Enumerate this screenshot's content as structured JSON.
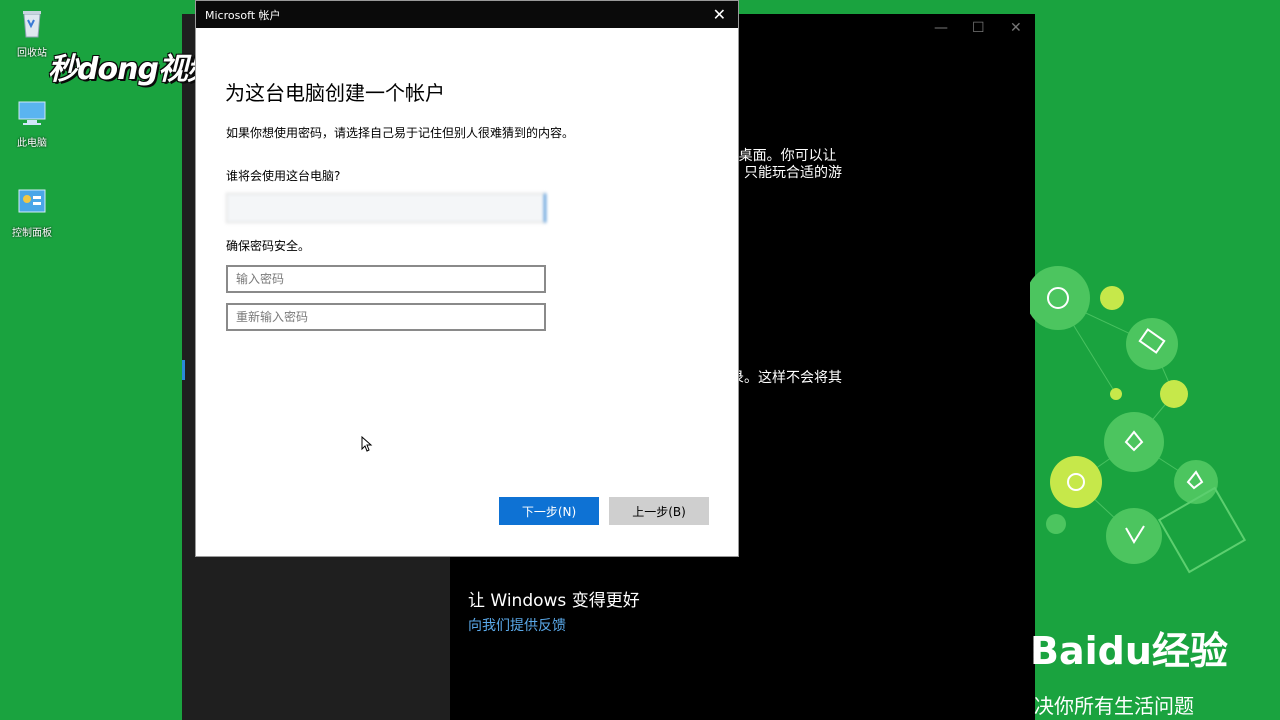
{
  "desktop": {
    "icons": [
      {
        "label": "回收站"
      },
      {
        "label": "此电脑"
      },
      {
        "label": "控制面板"
      }
    ]
  },
  "watermark": {
    "top_left": "秒dong视频",
    "brand_logo": "Baidu经验",
    "brand_sub": "决你所有生活问题"
  },
  "settings_bg": {
    "text1": "o桌面。你可以让\n，只能玩合适的游",
    "text2": "录。这样不会将其",
    "heading": "让 Windows 变得更好",
    "link": "向我们提供反馈"
  },
  "dialog": {
    "window_title": "Microsoft 帐户",
    "title": "为这台电脑创建一个帐户",
    "description": "如果你想使用密码，请选择自己易于记住但别人很难猜到的内容。",
    "who_label": "谁将会使用这台电脑?",
    "security_label": "确保密码安全。",
    "password_placeholder": "输入密码",
    "reenter_placeholder": "重新输入密码",
    "next_label": "下一步(N)",
    "back_label": "上一步(B)"
  },
  "colors": {
    "desktop_bg": "#1aa33f",
    "accent_blue": "#0e72d4",
    "titlebar": "#0a0a0a"
  }
}
